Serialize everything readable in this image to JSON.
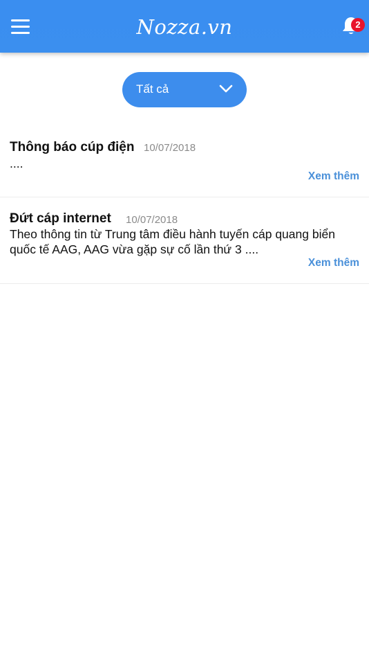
{
  "header": {
    "brand": "Nozza.vn",
    "notification_count": "2"
  },
  "filter": {
    "selected": "Tất cả"
  },
  "notifications": [
    {
      "title": "Thông báo cúp điện",
      "date": "10/07/2018",
      "body": "....",
      "more_label": "Xem thêm"
    },
    {
      "title": "Đứt cáp internet",
      "date": "10/07/2018",
      "body": "Theo thông tin từ Trung tâm điều hành tuyến cáp quang biển quốc tế AAG, AAG vừa gặp sự cố lần thứ 3 ....",
      "more_label": "Xem thêm"
    }
  ],
  "colors": {
    "header": "#3b8fef",
    "accent": "#4a90d9",
    "badge": "#e8142c"
  },
  "icons": [
    "menu-icon",
    "bell-icon",
    "chevron-down-icon"
  ]
}
